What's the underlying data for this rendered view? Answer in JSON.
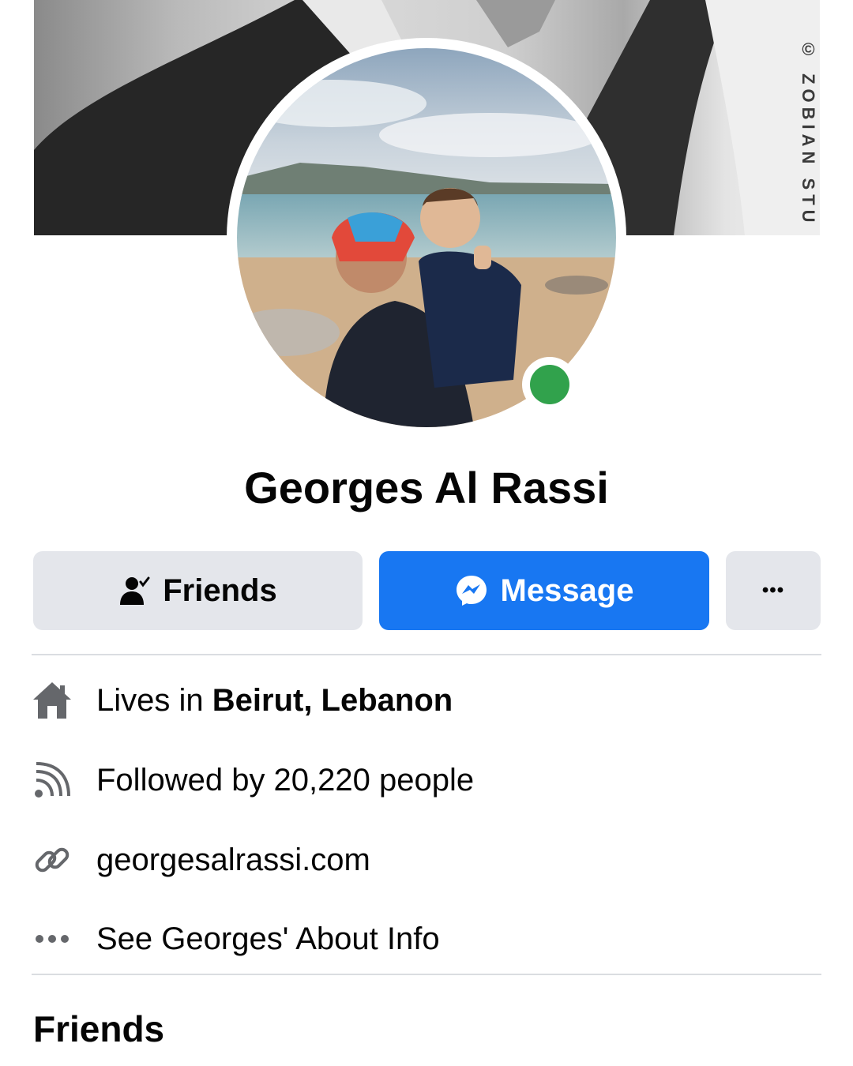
{
  "cover": {
    "watermark": "© ZOBIAN STU"
  },
  "profile": {
    "name": "Georges Al Rassi",
    "online": true,
    "online_color": "#31a24c"
  },
  "actions": {
    "friends_label": "Friends",
    "message_label": "Message",
    "more_label": "•••",
    "message_color": "#1877f2",
    "secondary_color": "#e4e6eb"
  },
  "info": {
    "lives_prefix": "Lives in ",
    "lives_city": "Beirut, Lebanon",
    "followers": "Followed by 20,220 people",
    "website": "georgesalrassi.com",
    "about": "See Georges' About Info"
  },
  "sections": {
    "friends_title": "Friends"
  },
  "icons": {
    "friends": "person-check-icon",
    "message": "messenger-icon",
    "more": "more-dots-icon",
    "lives": "home-icon",
    "followers": "rss-feed-icon",
    "website": "link-icon",
    "about": "ellipsis-icon"
  }
}
